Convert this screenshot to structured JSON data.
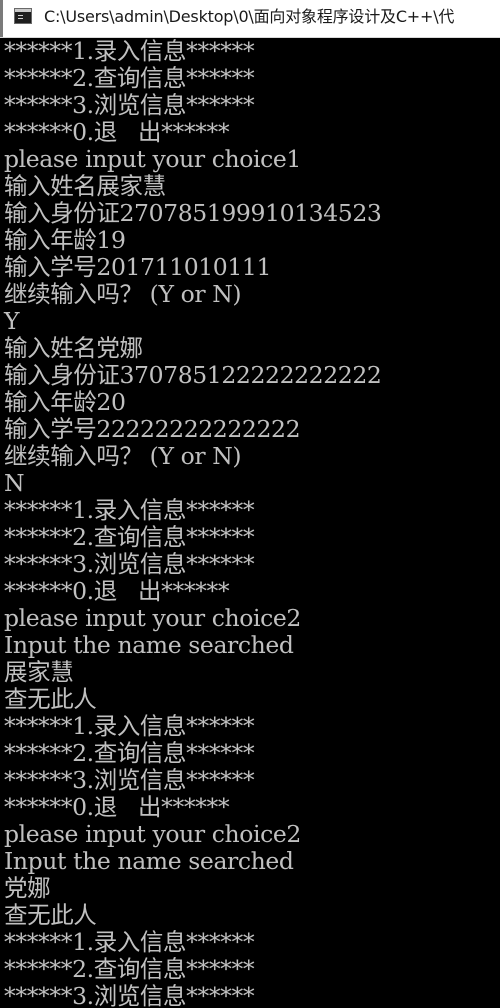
{
  "window": {
    "title": "C:\\Users\\admin\\Desktop\\0\\面向对象程序设计及C++\\代"
  },
  "icons": {
    "app": "console-app-icon"
  },
  "colors": {
    "console_background": "#000000",
    "console_text": "#c0c0c0",
    "titlebar_background": "#ffffff"
  },
  "console": {
    "lines": [
      "******1.录入信息******",
      "******2.查询信息******",
      "******3.浏览信息******",
      "******0.退   出******",
      "please input your choice1",
      "输入姓名展家慧",
      "输入身份证270785199910134523",
      "输入年龄19",
      "输入学号201711010111",
      "继续输入吗？ (Y or N)",
      "Y",
      "输入姓名党娜",
      "输入身份证370785122222222222",
      "输入年龄20",
      "输入学号22222222222222",
      "继续输入吗？ (Y or N)",
      "N",
      "******1.录入信息******",
      "******2.查询信息******",
      "******3.浏览信息******",
      "******0.退   出******",
      "please input your choice2",
      "Input the name searched",
      "展家慧",
      "查无此人",
      "******1.录入信息******",
      "******2.查询信息******",
      "******3.浏览信息******",
      "******0.退   出******",
      "please input your choice2",
      "Input the name searched",
      "党娜",
      "查无此人",
      "******1.录入信息******",
      "******2.查询信息******",
      "******3.浏览信息******"
    ]
  }
}
